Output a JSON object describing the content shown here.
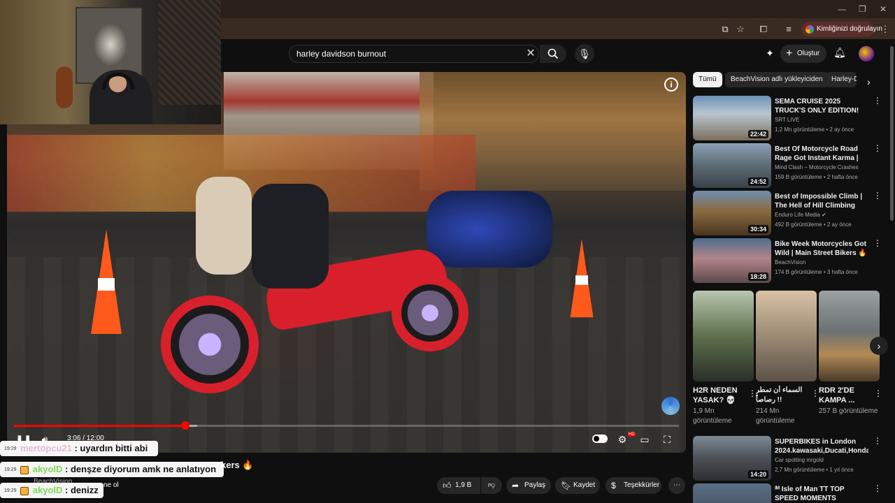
{
  "browser": {
    "window_controls": [
      "—",
      "❐",
      "✕"
    ],
    "verify_label": "Kimliğinizi doğrulayın"
  },
  "header": {
    "search_value": "harley davidson burnout",
    "create_label": "Oluştur"
  },
  "player": {
    "time": "3:06 / 12:00",
    "progress_fraction": 0.258,
    "buffer_fraction": 0.276
  },
  "video": {
    "title_tail": "kers 🔥",
    "channel": "BeachVision",
    "subscribe_tail": "ne ol",
    "like_count": "1,9 B",
    "share_label": "Paylaş",
    "save_label": "Kaydet",
    "thanks_label": "Teşekkürler"
  },
  "chat": [
    {
      "time": "19:29",
      "user": "mertopcu21",
      "user_color": "#e8b7d8",
      "message": ": uyardın bitti abi",
      "badge": false
    },
    {
      "time": "19:29",
      "user": "akyolD",
      "user_color": "#7ed957",
      "message": ": denşze diyorum amk ne anlatıyon",
      "badge": true
    },
    {
      "time": "19:29",
      "user": "akyolD",
      "user_color": "#7ed957",
      "message": ": denizz",
      "badge": true
    }
  ],
  "sidebar": {
    "chips": [
      "Tümü",
      "BeachVision adlı yükleyiciden",
      "Harley-D"
    ],
    "videos": [
      {
        "title": "SEMA CRUISE 2025 TRUCK'S ONLY EDITION!",
        "channel": "SRT LIVE",
        "meta": "1,2 Mn görüntüleme • 2 ay önce",
        "duration": "22:42"
      },
      {
        "title": "Best Of Motorcycle Road Rage Got Instant Karma | Motorcycl...",
        "channel": "Mind Clash – Motorcycle Crashes",
        "meta": "159 B görüntüleme • 2 hafta önce",
        "duration": "24:52"
      },
      {
        "title": "Best of Impossible Climb | The Hell of Hill Climbing",
        "channel": "Enduro Life Media ✔",
        "meta": "492 B görüntüleme • 2 ay önce",
        "duration": "30:34"
      },
      {
        "title": "Bike Week Motorcycles Got Wild | Main Street Bikers 🔥",
        "channel": "BeachVision",
        "meta": "174 B görüntüleme • 3 hafta önce",
        "duration": "18:28"
      }
    ],
    "shorts": [
      {
        "title": "H2R NEDEN YASAK? 💀",
        "views": "1,9 Mn görüntüleme"
      },
      {
        "title": "السماء أن تمطر رصاصاً !!",
        "views": "214 Mn görüntüleme"
      },
      {
        "title": "RDR 2'DE KAMPA ...",
        "views": "257 B görüntüleme"
      }
    ],
    "videos_after": [
      {
        "title": "SUPERBIKES in London 2024.kawasaki,Ducati,Honda,...",
        "channel": "Car spotting mrgold",
        "meta": "2,7 Mn görüntüleme • 1 yıl önce",
        "duration": "14:20"
      },
      {
        "title": "ᴵᴹ Isle of Man TT TOP SPEED MOMENTS",
        "channel": "",
        "meta": "",
        "duration": ""
      }
    ]
  }
}
